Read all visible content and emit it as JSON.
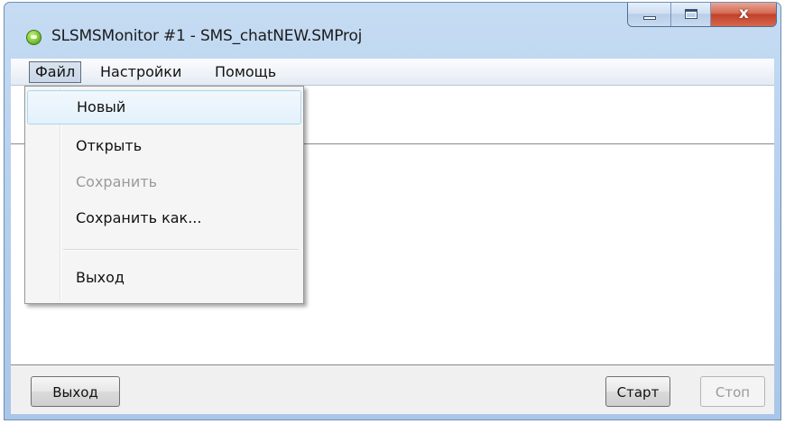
{
  "window": {
    "title": "SLSMSMonitor #1 - SMS_chatNEW.SMProj",
    "close_glyph": "x",
    "icon": "app-sms-icon"
  },
  "menubar": {
    "file": "Файл",
    "settings": "Настройки",
    "help": "Помощь"
  },
  "file_menu": {
    "items": [
      {
        "label": "Новый",
        "state": "highlighted"
      },
      {
        "label": "Открыть",
        "state": "enabled"
      },
      {
        "label": "Сохранить",
        "state": "disabled"
      },
      {
        "label": "Сохранить как...",
        "state": "enabled"
      },
      {
        "label": "Выход",
        "state": "enabled"
      }
    ]
  },
  "buttons": {
    "exit": "Выход",
    "start": "Старт",
    "stop": "Стоп",
    "stop_enabled": false
  },
  "colors": {
    "title_bar": "#b7d1ee",
    "close_button": "#c2412a",
    "menu_highlight": "#e3f1fb",
    "disabled_text": "#9a9a9a"
  }
}
